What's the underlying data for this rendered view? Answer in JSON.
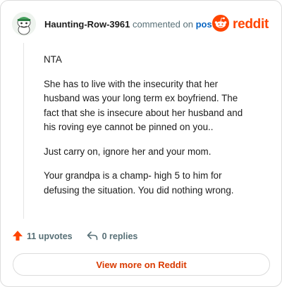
{
  "comment": {
    "author": "Haunting-Row-3961",
    "commented_on_text": "commented on",
    "post_link_text": "post",
    "avatar_icon": "snoo-avatar-icon",
    "paragraphs": [
      "NTA",
      "She has to live with the insecurity that her husband was your long term ex boyfriend. The fact that she is insecure about her husband and his roving eye cannot be pinned on you..",
      "Just carry on, ignore her and your mom.",
      "Your grandpa is a champ- high 5 to him for defusing the situation. You did nothing wrong."
    ]
  },
  "brand": {
    "name": "reddit",
    "icon": "reddit-logo-icon",
    "color": "#ff4500"
  },
  "footer": {
    "upvotes": "11 upvotes",
    "replies": "0 replies",
    "upvote_icon": "upvote-arrow-icon",
    "reply_icon": "reply-arrow-icon",
    "upvote_color": "#ff4500"
  },
  "actions": {
    "view_more": "View more on Reddit"
  }
}
